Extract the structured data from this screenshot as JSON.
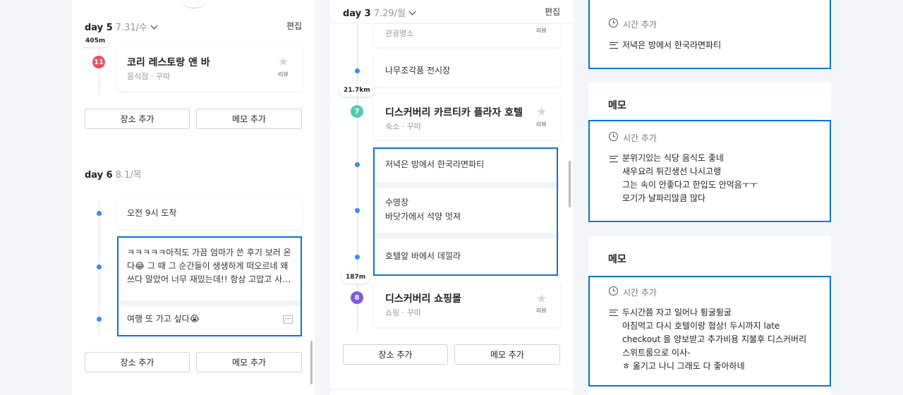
{
  "panel1": {
    "day5": {
      "label": "day 5",
      "date": "7.31/수",
      "edit_label": "편집"
    },
    "dist_top": "405m",
    "place11": {
      "number": "11",
      "title": "코리 레스토랑 앤 바",
      "subtitle": "음식점 · 꾸따",
      "review_label": "리뷰"
    },
    "add_place_label": "장소 추가",
    "add_memo_label": "메모 추가",
    "day6": {
      "label": "day 6",
      "date": "8.1/목"
    },
    "memo_arrival": "오전 9시 도착",
    "memo_long": "ㅋㅋㅋㅋㅋ아직도 가끔 엄마가 쓴 후기 보러 온다😂 그 때 그 순간들이 생생하게 떠오르네 왜 쓰다 말았어 너무 재밌는데!! 항상 고맙고 사…",
    "memo_travel": "여행 또 가고 싶다😭"
  },
  "panel2": {
    "day3": {
      "label": "day 3",
      "date": "7.29/월",
      "edit_label": "편집"
    },
    "partial_sub": "관광명소",
    "review_label": "리뷰",
    "memo_woodcraft": "나무조각품 전시장",
    "dist1": "21.7km",
    "place7": {
      "number": "7",
      "title": "디스커버리 카르티카 플라자 호텔",
      "subtitle": "숙소 · 꾸따"
    },
    "memo_dinner": "저녁은 방에서 한국라면파티",
    "memo_pool_title": "수영장",
    "memo_pool_body": "바닷가에서 석양 멋져",
    "memo_hotelbar": "호텔앞 바에서 데낄라",
    "dist2": "187m",
    "place8": {
      "number": "8",
      "title": "디스커버리 쇼핑몰",
      "subtitle": "쇼핑 · 꾸따"
    },
    "add_place_label": "장소 추가",
    "add_memo_label": "메모 추가"
  },
  "panel3": {
    "card1": {
      "time_add": "시간 추가",
      "text": "저녁은 방에서 한국라면파티"
    },
    "card2": {
      "title": "메모",
      "time_add": "시간 추가",
      "text": "분위기있는 식당 음식도 좋네\n새우요리 튀긴생선 나시고랭\n그는 속이 안좋다고 한입도 안먹음ㅜㅜ\n모기가 날파리많큼 많다"
    },
    "card3": {
      "title": "메모",
      "time_add": "시간 추가",
      "text": "두시간쯤 자고 일어나 튕굴튕굴\n아침먹고 다시 호텔이랑 협상! 두시까지 late\ncheckout 을 양보받고 추가비용 지불후 디스커버리\n스위트룸으로 이사-\nㅎ 옮기고 나니 그래도 다 좋아하네"
    }
  },
  "colors": {
    "accent_blue": "#0a72e0",
    "dot_blue": "#3b8cf0",
    "marker_red": "#e8525a",
    "marker_teal": "#56c7b4",
    "marker_purple": "#7b5ce0"
  },
  "icons": [
    "chevron-down-icon",
    "star-icon",
    "clock-icon",
    "text-lines-icon",
    "image-icon"
  ]
}
